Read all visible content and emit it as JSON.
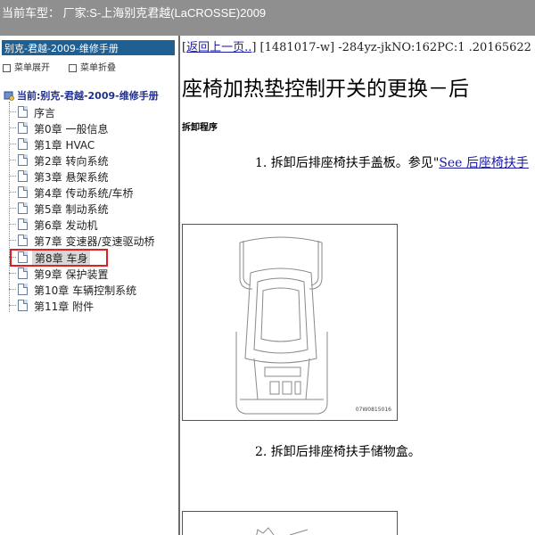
{
  "titlebar": {
    "text": "当前车型：  厂家:S-上海别克君越(LaCROSSE)2009"
  },
  "sidebar": {
    "header": "别克-君越-2009-维修手册",
    "expand_label": "菜单展开",
    "collapse_label": "菜单折叠",
    "root_label": "当前:别克-君越-2009-维修手册",
    "items": [
      {
        "label": "序言"
      },
      {
        "label": "第0章 一般信息"
      },
      {
        "label": "第1章 HVAC"
      },
      {
        "label": "第2章 转向系统"
      },
      {
        "label": "第3章 悬架系统"
      },
      {
        "label": "第4章 传动系统/车桥"
      },
      {
        "label": "第5章 制动系统"
      },
      {
        "label": "第6章 发动机"
      },
      {
        "label": "第7章 变速器/变速驱动桥"
      },
      {
        "label": "第8章 车身",
        "selected": true
      },
      {
        "label": "第9章 保护装置"
      },
      {
        "label": "第10章 车辆控制系统"
      },
      {
        "label": "第11章 附件"
      }
    ]
  },
  "content": {
    "bracket_open": "[",
    "back_link": "返回上一页..",
    "nav_rest": "] [1481017-w] -284yz-jkNO:162PC:1 .20165622",
    "title": "座椅加热垫控制开关的更换－后",
    "section_label": "拆卸程序",
    "step1_text": "1. 拆卸后排座椅扶手盖板。参见",
    "step1_quote": "\"",
    "step1_link": "See 后座椅扶手",
    "figure1_code": "07W0815016",
    "step2_text": "2. 拆卸后排座椅扶手储物盒。"
  }
}
